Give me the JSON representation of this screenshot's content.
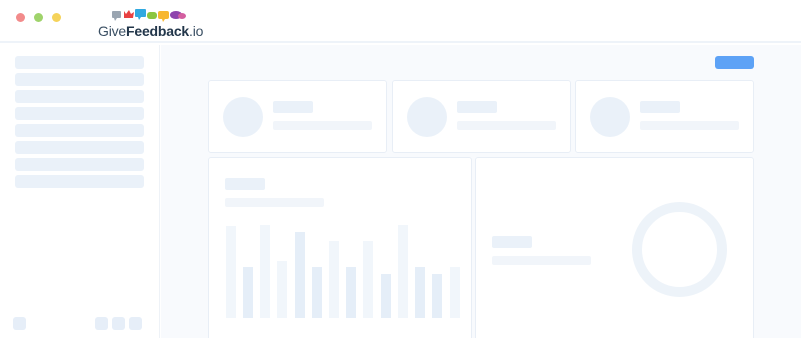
{
  "window": {
    "controls": [
      "close",
      "minimize",
      "maximize"
    ]
  },
  "logo": {
    "prefix": "Give",
    "bold": "Feedback",
    "suffix": ".io"
  },
  "colors": {
    "accent": "#5da2f6",
    "placeholder": "#eaf1f9",
    "background": "#f8fafd"
  },
  "skeleton": {
    "sidebar_items": 8,
    "stat_cards": 3,
    "chart_bars": 14
  }
}
